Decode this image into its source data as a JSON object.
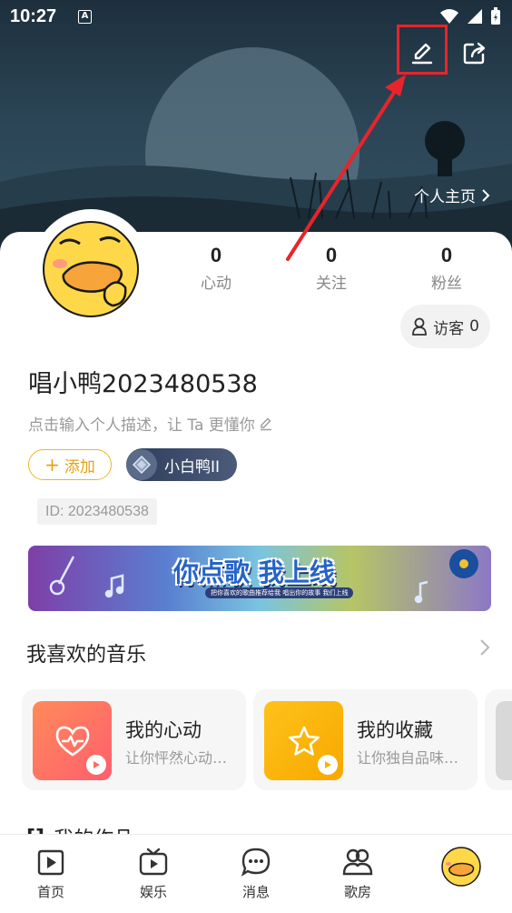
{
  "status_bar": {
    "time": "10:27",
    "notification_icon": "A"
  },
  "header": {
    "edit_icon": "pencil-icon",
    "share_icon": "share-icon",
    "home_link": "个人主页"
  },
  "profile": {
    "stats": [
      {
        "value": "0",
        "label": "心动"
      },
      {
        "value": "0",
        "label": "关注"
      },
      {
        "value": "0",
        "label": "粉丝"
      }
    ],
    "visitor": {
      "label": "访客",
      "count": "0"
    },
    "username": "唱小鸭2023480538",
    "description_placeholder": "点击输入个人描述，让 Ta 更懂你",
    "add_button": "添加",
    "level_badge": "小白鸭II",
    "id_text": "ID: 2023480538"
  },
  "banner": {
    "title": "你点歌 我上线",
    "subtitle": "把你喜欢的歌曲推荐给我 唱出你的故事 我们上线"
  },
  "favorites": {
    "title": "我喜欢的音乐",
    "cards": [
      {
        "name": "我的心动",
        "subtitle": "让你怦然心动…",
        "color": "#ff6b5a"
      },
      {
        "name": "我的收藏",
        "subtitle": "让你独自品味…",
        "color": "#f7b500"
      }
    ]
  },
  "works": {
    "title": "我的作品"
  },
  "nav": {
    "items": [
      {
        "label": "首页",
        "icon": "home-play-icon"
      },
      {
        "label": "娱乐",
        "icon": "tv-icon"
      },
      {
        "label": "消息",
        "icon": "message-icon"
      },
      {
        "label": "歌房",
        "icon": "room-icon"
      }
    ]
  },
  "colors": {
    "accent": "#f5b322",
    "highlight": "#e8242b",
    "badge": "#3c4a68"
  }
}
